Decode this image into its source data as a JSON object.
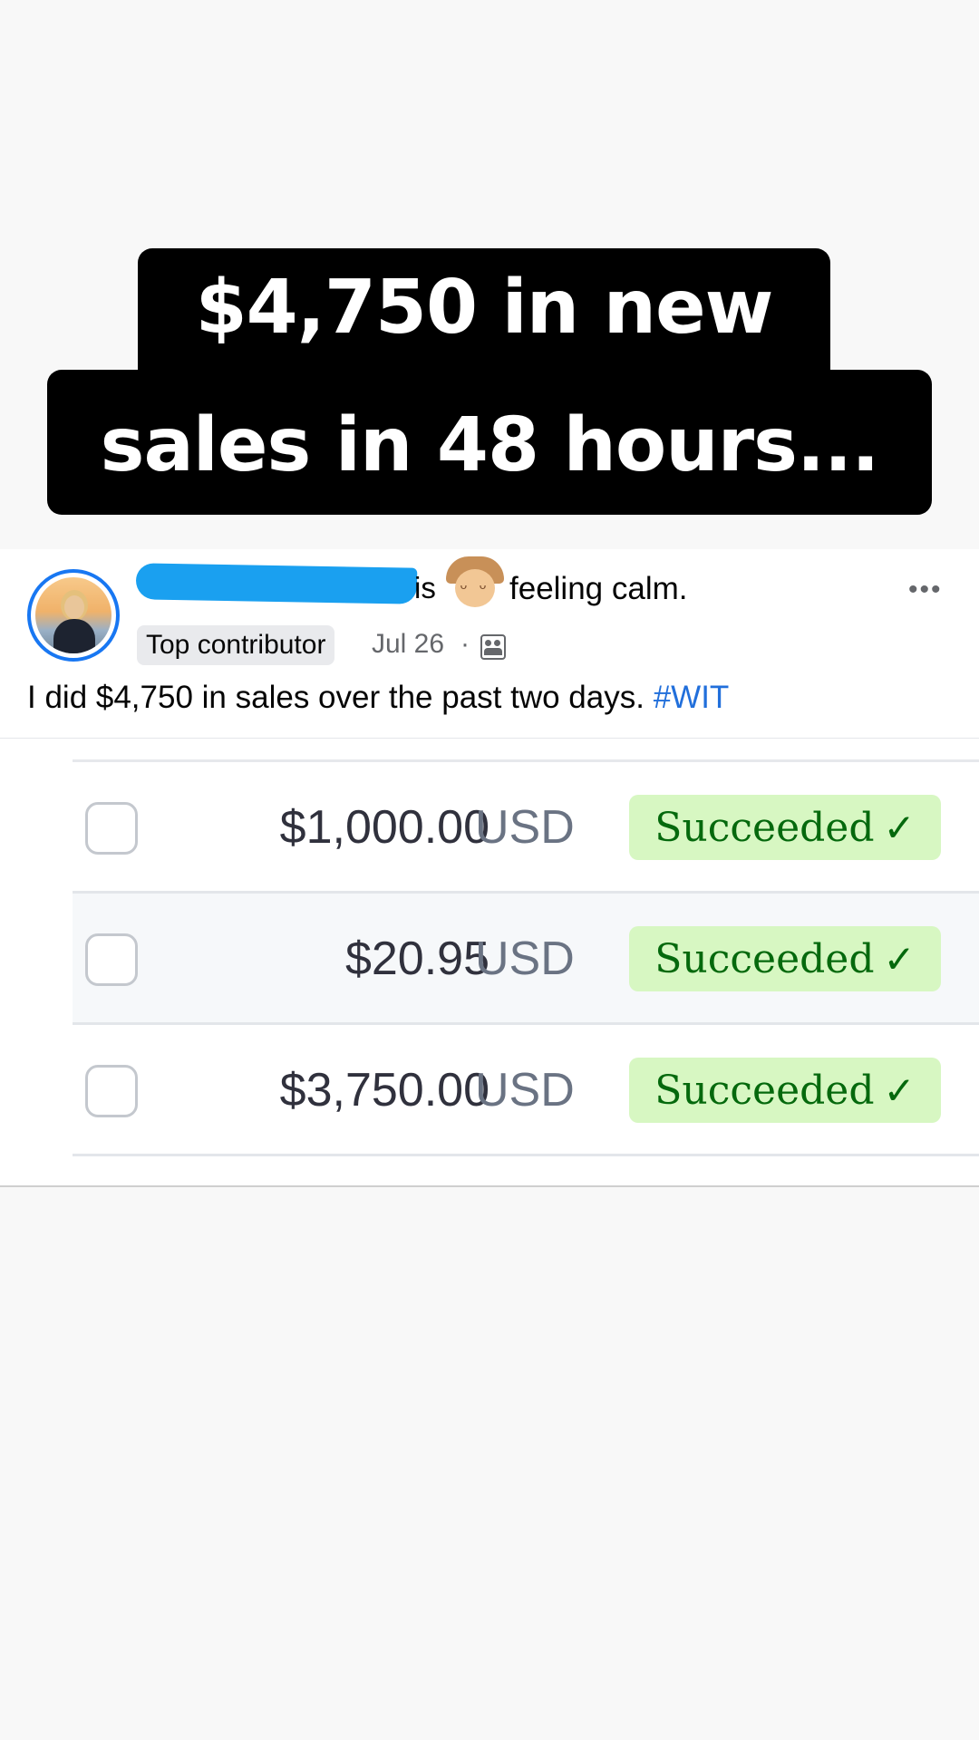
{
  "headline": {
    "line1": "$4,750 in new",
    "line2": "sales in 48 hours..."
  },
  "post": {
    "author_suffix": "is",
    "feeling": "feeling calm.",
    "badge": "Top contributor",
    "date": "Jul 26",
    "separator": "·",
    "text": "I did $4,750 in sales over the past two days.",
    "hashtag": "#WIT",
    "more_icon": "•••"
  },
  "payments": [
    {
      "amount": "$1,000.00",
      "currency": "USD",
      "status": "Succeeded",
      "status_icon": "✓"
    },
    {
      "amount": "$20.95",
      "currency": "USD",
      "status": "Succeeded",
      "status_icon": "✓"
    },
    {
      "amount": "$3,750.00",
      "currency": "USD",
      "status": "Succeeded",
      "status_icon": "✓"
    }
  ],
  "colors": {
    "headline_bg": "#000000",
    "headline_text": "#ffffff",
    "hashtag": "#216fdb",
    "status_bg": "#d7f7c2",
    "status_text": "#05690d",
    "avatar_ring": "#1877f2"
  }
}
